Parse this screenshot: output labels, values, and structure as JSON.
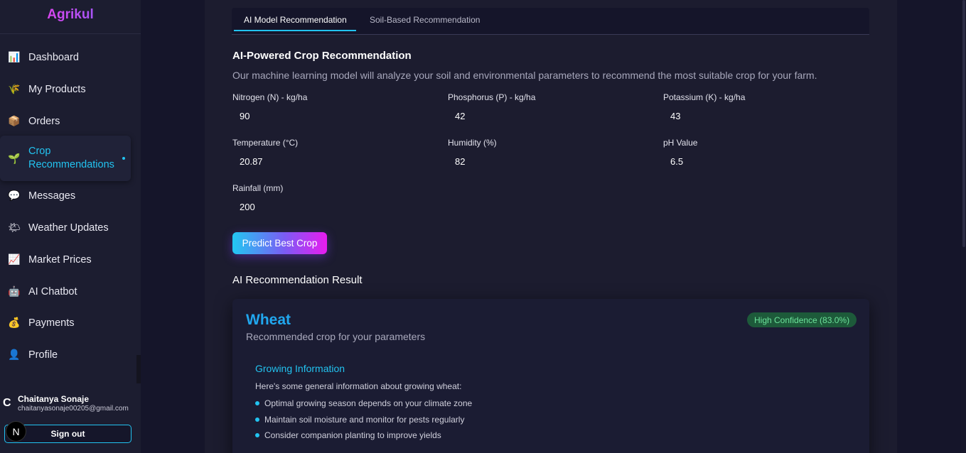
{
  "app": {
    "brand": "Agrikul"
  },
  "sidebar": {
    "items": [
      {
        "label": "Dashboard",
        "icon": "📊"
      },
      {
        "label": "My Products",
        "icon": "🌾"
      },
      {
        "label": "Orders",
        "icon": "📦"
      },
      {
        "label": "Crop Recommendations",
        "icon": "🌱"
      },
      {
        "label": "Messages",
        "icon": "💬"
      },
      {
        "label": "Weather Updates",
        "icon": "🌤"
      },
      {
        "label": "Market Prices",
        "icon": "📈"
      },
      {
        "label": "AI Chatbot",
        "icon": "🤖"
      },
      {
        "label": "Payments",
        "icon": "💰"
      },
      {
        "label": "Profile",
        "icon": "👤"
      }
    ],
    "user": {
      "initial": "C",
      "name": "Chaitanya Sonaje",
      "email": "chaitanyasonaje00205@gmail.com",
      "signout_label": "Sign out",
      "badge": "N"
    }
  },
  "tabs": {
    "ai": "AI Model Recommendation",
    "soil": "Soil-Based Recommendation"
  },
  "form": {
    "title": "AI-Powered Crop Recommendation",
    "description": "Our machine learning model will analyze your soil and environmental parameters to recommend the most suitable crop for your farm.",
    "fields": {
      "nitrogen": {
        "label": "Nitrogen (N) - kg/ha",
        "value": "90"
      },
      "phosphorus": {
        "label": "Phosphorus (P) - kg/ha",
        "value": "42"
      },
      "potassium": {
        "label": "Potassium (K) - kg/ha",
        "value": "43"
      },
      "temperature": {
        "label": "Temperature (°C)",
        "value": "20.87"
      },
      "humidity": {
        "label": "Humidity (%)",
        "value": "82"
      },
      "ph": {
        "label": "pH Value",
        "value": "6.5"
      },
      "rainfall": {
        "label": "Rainfall (mm)",
        "value": "200"
      }
    },
    "predict_label": "Predict Best Crop"
  },
  "result": {
    "heading": "AI Recommendation Result",
    "crop": "Wheat",
    "subtitle": "Recommended crop for your parameters",
    "confidence": "High Confidence (83.0%)",
    "info_title": "Growing Information",
    "info_desc": "Here's some general information about growing wheat:",
    "bullets": [
      "Optimal growing season depends on your climate zone",
      "Maintain soil moisture and monitor for pests regularly",
      "Consider companion planting to improve yields"
    ]
  },
  "colors": {
    "accent": "#22c3f0",
    "brand": "#d946ef",
    "confidence_bg": "#1d5a3a"
  }
}
